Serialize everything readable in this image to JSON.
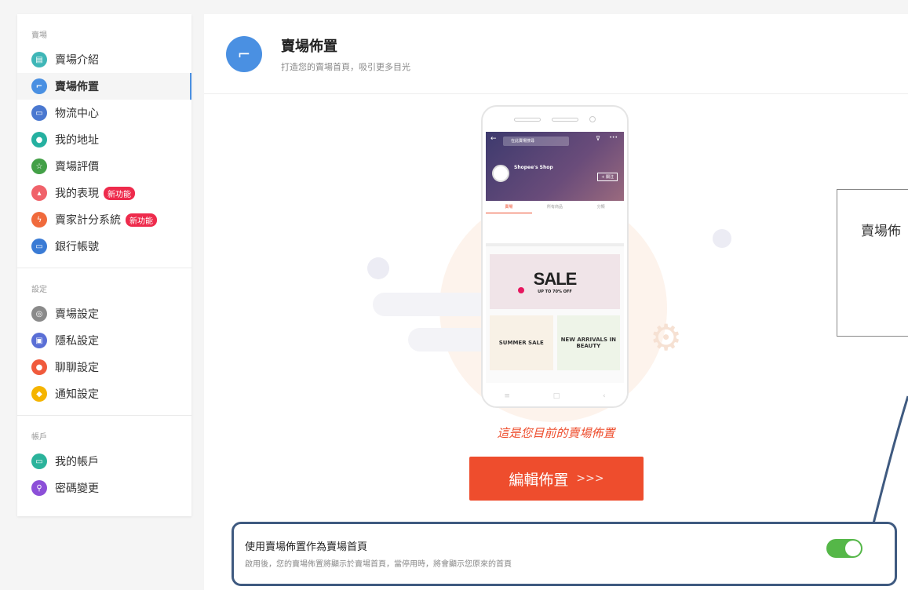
{
  "sidebar": {
    "sections": [
      {
        "title": "賣場",
        "items": [
          {
            "label": "賣場介紹",
            "color": "#3fb6b7",
            "icon": "▤"
          },
          {
            "label": "賣場佈置",
            "color": "#4a90e2",
            "icon": "⌐",
            "active": true
          },
          {
            "label": "物流中心",
            "color": "#4a78d0",
            "icon": "▭"
          },
          {
            "label": "我的地址",
            "color": "#25b0a0",
            "icon": "●"
          },
          {
            "label": "賣場評價",
            "color": "#43a047",
            "icon": "☆"
          },
          {
            "label": "我的表現",
            "color": "#f0626a",
            "icon": "▴",
            "badge": "新功能"
          },
          {
            "label": "賣家計分系統",
            "color": "#f06a3c",
            "icon": "ϟ",
            "badge": "新功能"
          },
          {
            "label": "銀行帳號",
            "color": "#3a7bd5",
            "icon": "▭"
          }
        ]
      },
      {
        "title": "設定",
        "items": [
          {
            "label": "賣場設定",
            "color": "#8a8a8a",
            "icon": "◎"
          },
          {
            "label": "隱私設定",
            "color": "#5a6fd6",
            "icon": "▣"
          },
          {
            "label": "聊聊設定",
            "color": "#f05a3c",
            "icon": "●"
          },
          {
            "label": "通知設定",
            "color": "#f5b400",
            "icon": "◆"
          }
        ]
      },
      {
        "title": "帳戶",
        "items": [
          {
            "label": "我的帳戶",
            "color": "#2bb39b",
            "icon": "▭"
          },
          {
            "label": "密碼變更",
            "color": "#8c4fd8",
            "icon": "⚲"
          }
        ]
      }
    ]
  },
  "header": {
    "title": "賣場佈置",
    "subtitle": "打造您的賣場首頁，吸引更多目光"
  },
  "phone": {
    "search_placeholder": "在此賣場搜尋",
    "shop_name": "Shopee's Shop",
    "follow": "+ 關注",
    "tabs": [
      "賣場",
      "所有商品",
      "分類"
    ],
    "sale_title": "SALE",
    "sale_sub": "UP TO 70% OFF",
    "promo_left": "SUMMER SALE",
    "promo_right": "NEW ARRIVALS IN BEAUTY"
  },
  "caption": "這是您目前的賣場佈置",
  "edit_button": {
    "label": "編輯佈置",
    "arrows": ">>>"
  },
  "callout": {
    "text": "賣場佈"
  },
  "toggle_section": {
    "title": "使用賣場佈置作為賣場首頁",
    "description": "啟用後，您的賣場佈置將顯示於賣場首頁，當停用時，將會顯示您原來的首頁",
    "enabled": true
  }
}
